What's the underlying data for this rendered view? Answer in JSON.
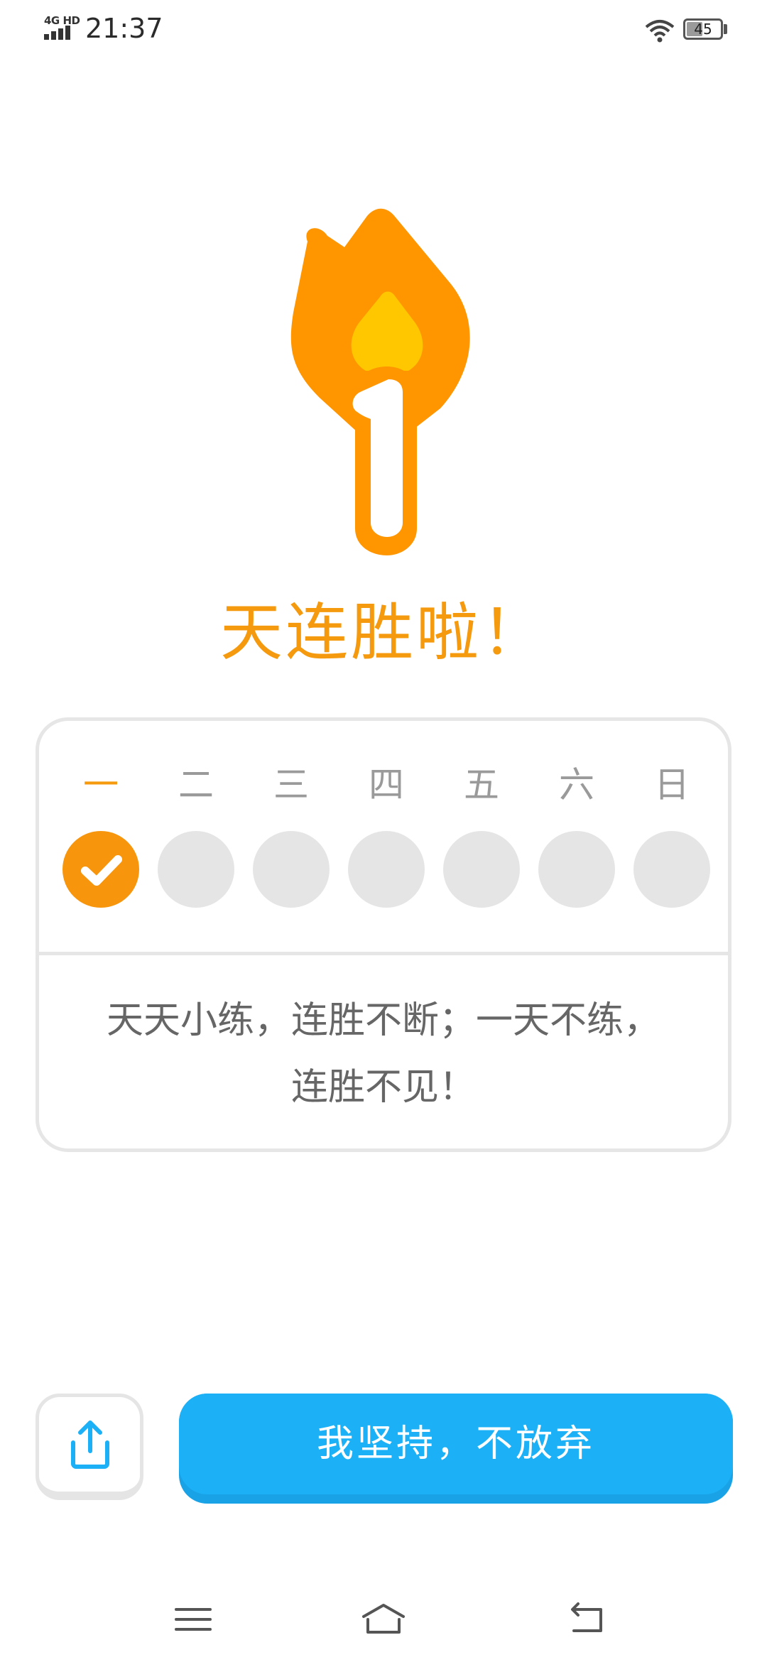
{
  "status_bar": {
    "network": "4G HD",
    "time": "21:37",
    "battery": "45",
    "battery_level": 0.45
  },
  "streak": {
    "count": "1",
    "headline": "天连胜啦！"
  },
  "week": {
    "days": [
      "一",
      "二",
      "三",
      "四",
      "五",
      "六",
      "日"
    ],
    "completed": [
      true,
      false,
      false,
      false,
      false,
      false,
      false
    ]
  },
  "motto": {
    "line1": "天天小练，连胜不断；一天不练，",
    "line2": "连胜不见！"
  },
  "actions": {
    "continue_label": "我坚持，不放弃"
  },
  "colors": {
    "streak_orange": "#f59a0e",
    "flame_yellow": "#ffc700",
    "button_blue": "#1cb0f6",
    "inactive_gray": "#e5e5e5"
  },
  "icons": {
    "share": "share-icon",
    "check": "check-icon",
    "menu": "menu-icon",
    "home": "home-icon",
    "back": "back-icon"
  }
}
